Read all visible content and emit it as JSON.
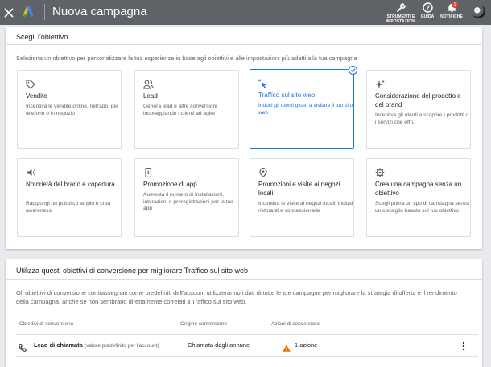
{
  "header": {
    "title": "Nuova campagna",
    "tools_label_line1": "STRUMENTI E",
    "tools_label_line2": "IMPOSTAZIONI",
    "help_label": "GUIDA",
    "notifications_label": "NOTIFICHE",
    "notifications_count": "1",
    "background_color": "#5f6368"
  },
  "objective_section": {
    "title": "Scegli l'obiettivo",
    "intro": "Seleziona un obiettivo per personalizzare la tua esperienza in base agli obiettivi e alle impostazioni più adatti alla tua campagna",
    "objectives": [
      {
        "icon": "tag-icon",
        "title": "Vendite",
        "description": "Incentiva le vendite online, nell'app, per telefono o in negozio",
        "selected": false
      },
      {
        "icon": "people-icon",
        "title": "Lead",
        "description": "Genera lead e altre conversioni incoraggiando i clienti ad agire",
        "selected": false
      },
      {
        "icon": "cursor-click-icon",
        "title": "Traffico sul sito web",
        "description": "Induci gli utenti giusti a visitare il tuo sito web",
        "selected": true
      },
      {
        "icon": "sparkle-icon",
        "title": "Considerazione del prodotto e del brand",
        "description": "Incentiva gli utenti a scoprire i prodotti o i servizi che offri.",
        "selected": false
      },
      {
        "icon": "megaphone-icon",
        "title": "Notorietà del brand e copertura",
        "description": "Raggiungi un pubblico ampio e crea awareness",
        "selected": false
      },
      {
        "icon": "phone-app-icon",
        "title": "Promozione di app",
        "description": "Aumenta il numero di installazioni, interazioni e preregistrazioni per la tua app",
        "selected": false
      },
      {
        "icon": "location-pin-icon",
        "title": "Promozioni e visite ai negozi locali",
        "description": "Incentiva le visite ai negozi locali, inclusi ristoranti e concessionarie",
        "selected": false
      },
      {
        "icon": "gear-icon",
        "title": "Crea una campagna senza un obiettivo",
        "description": "Scegli prima un tipo di campagna senza un consiglio basato sul tuo obiettivo",
        "selected": false
      }
    ],
    "accent_color": "#1a73e8"
  },
  "conversion_section": {
    "title": "Utilizza questi obiettivi di conversione per migliorare Traffico sul sito web",
    "intro": "Gli obiettivi di conversione contrassegnati come predefiniti dell'account utilizzeranno i dati di tutte le tue campagne per migliorare la strategia di offerta e il rendimento della campagna, anche se non sembrano direttamente correlati a Traffico sul sito web.",
    "columns": [
      "Obiettivi di conversione",
      "Origine conversione",
      "Azioni di conversione"
    ],
    "rows": [
      {
        "name": "Lead di chiamata",
        "note": "(valore predefinito per l'account)",
        "origin": "Chiamata dagli annunci",
        "actions": "1 azione",
        "warning_color": "#e37400"
      }
    ]
  }
}
